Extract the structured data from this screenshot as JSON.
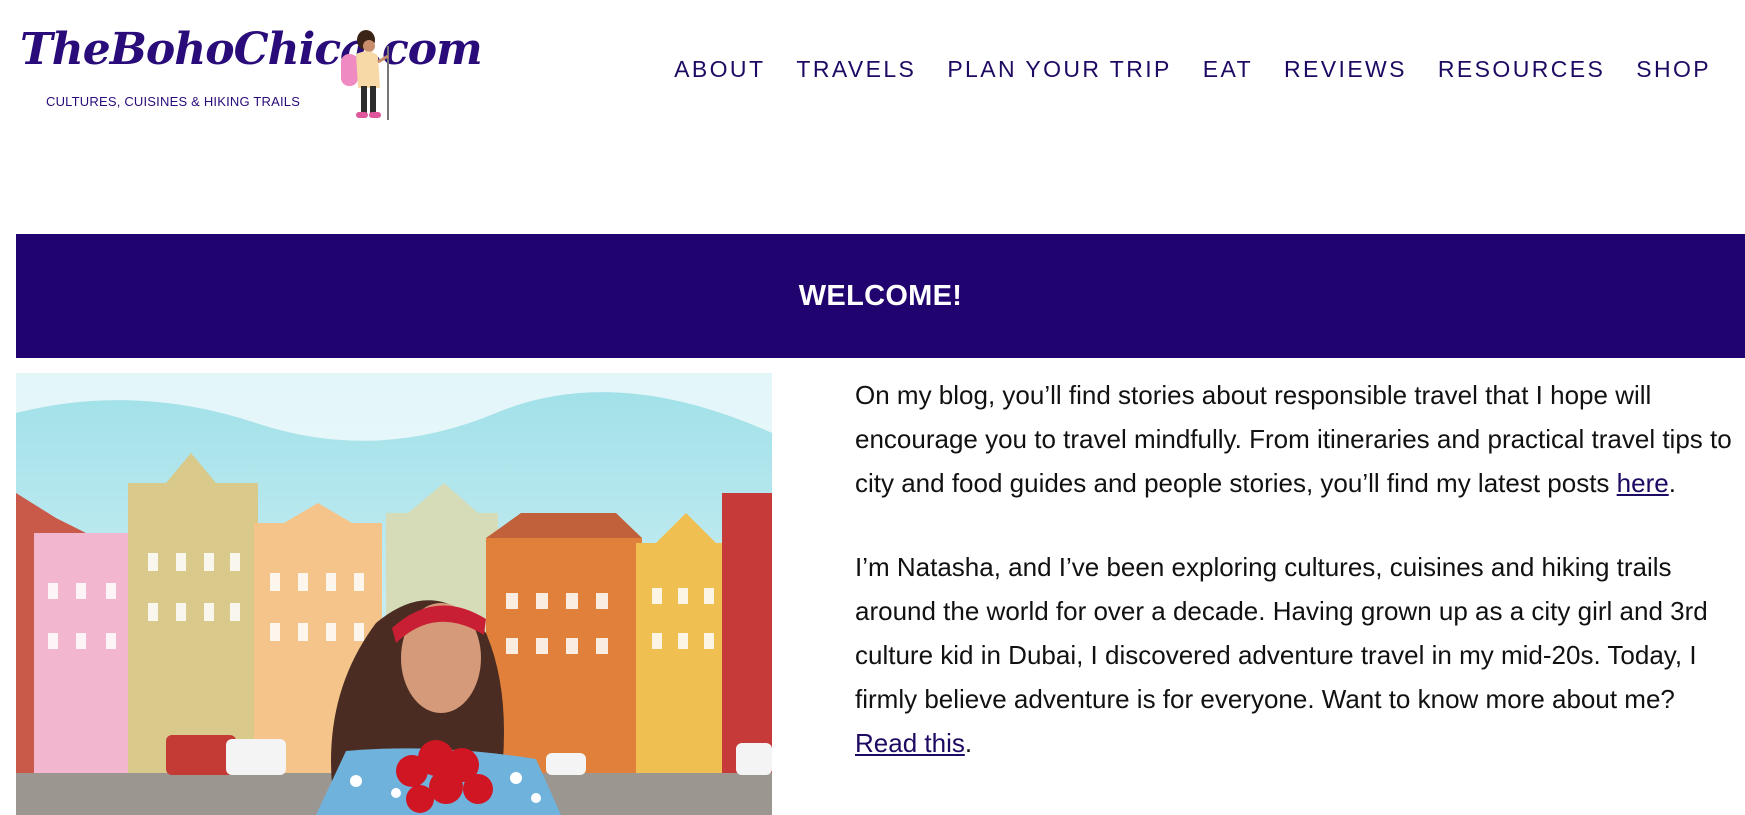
{
  "logo": {
    "title": "TheBohoChica.com",
    "subtitle": "CULTURES, CUISINES & HIKING TRAILS",
    "brand_color": "#2a0b7a"
  },
  "nav": {
    "items": [
      {
        "label": "ABOUT"
      },
      {
        "label": "TRAVELS"
      },
      {
        "label": "PLAN YOUR TRIP"
      },
      {
        "label": "EAT"
      },
      {
        "label": "REVIEWS"
      },
      {
        "label": "RESOURCES"
      },
      {
        "label": "SHOP"
      }
    ],
    "color": "#1f0a63"
  },
  "banner": {
    "title": "WELCOME!",
    "background": "#20036e"
  },
  "content": {
    "p1_text": "On my blog, you’ll find stories about responsible travel that I hope will encourage you to travel mindfully. From itineraries and practical travel tips to city and food guides and people stories, you’ll find my latest posts ",
    "p1_link": "here",
    "p1_end": ".",
    "p2_text": "I’m Natasha, and I’ve been exploring cultures, cuisines and hiking trails around the world for over a decade. Having grown up as a city girl and 3rd culture kid in Dubai, I discovered adventure travel in my mid-20s. Today, I firmly believe adventure is for everyone. Want to know more about me? ",
    "p2_link": "Read this",
    "p2_end": "."
  }
}
